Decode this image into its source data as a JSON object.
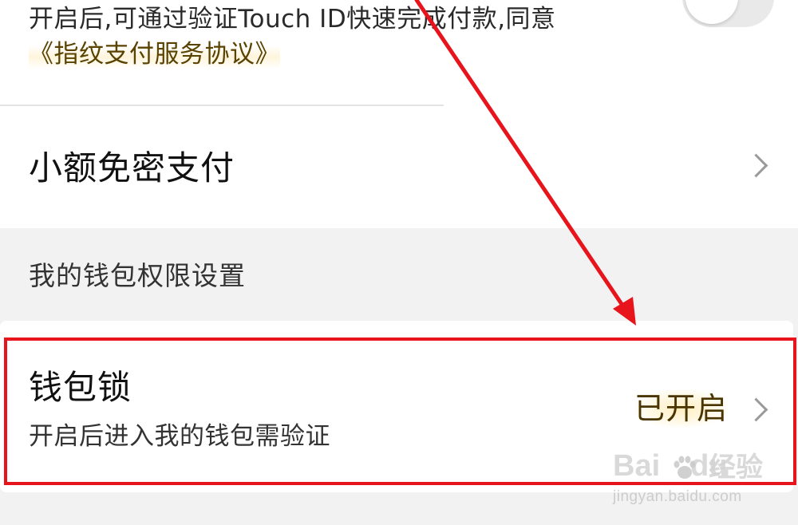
{
  "touch_id": {
    "description_prefix": "开启后,可通过验证Touch ID快速完成付款,同意",
    "agreement_link": "《指纹支付服务协议》",
    "toggle_state": "off"
  },
  "small_pay": {
    "label": "小额免密支付",
    "chevron_icon": "chevron-right-icon"
  },
  "section": {
    "title": "我的钱包权限设置"
  },
  "wallet_lock": {
    "title": "钱包锁",
    "subtitle": "开启后进入我的钱包需验证",
    "status": "已开启",
    "chevron_icon": "chevron-right-icon"
  },
  "annotation": {
    "highlight_color": "#e8141c",
    "arrow_color": "#e8141c"
  },
  "watermark": {
    "brand_left": "Bai",
    "brand_right": "du",
    "product": "经验",
    "url": "jingyan.baidu.com"
  }
}
